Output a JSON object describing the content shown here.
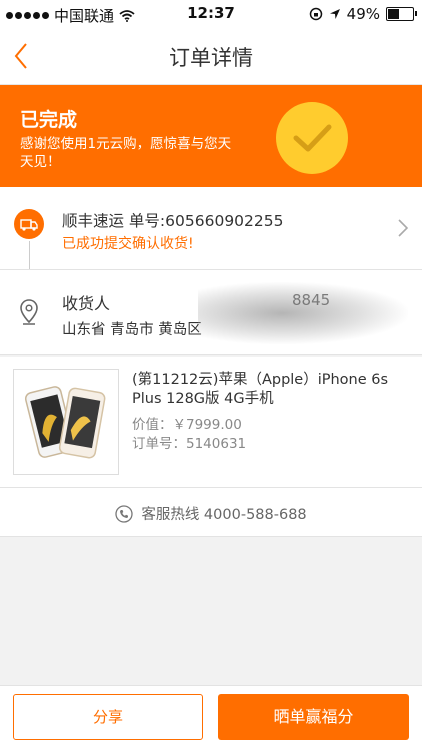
{
  "status_bar": {
    "carrier": "中国联通",
    "time": "12:37",
    "battery": "49%",
    "battery_level": 0.49
  },
  "header": {
    "title": "订单详情"
  },
  "banner": {
    "title": "已完成",
    "message": "感谢您使用1元云购，愿惊喜与您天天见！",
    "accent_color": "#ff6e00",
    "badge_color": "#ffcc2e"
  },
  "logistics": {
    "carrier_line": "顺丰速运  单号:605660902255",
    "status": "已成功提交确认收货!"
  },
  "address": {
    "label": "收货人",
    "phone": "8845",
    "line": "山东省 青岛市 黄岛区"
  },
  "product": {
    "name": "(第11212云)苹果（Apple）iPhone 6s Plus 128G版 4G手机",
    "price": "价值：￥7999.00",
    "order_no": "订单号：5140631"
  },
  "service": {
    "hotline": "客服热线 4000-588-688"
  },
  "actions": {
    "share": "分享",
    "show_order": "晒单赢福分"
  }
}
